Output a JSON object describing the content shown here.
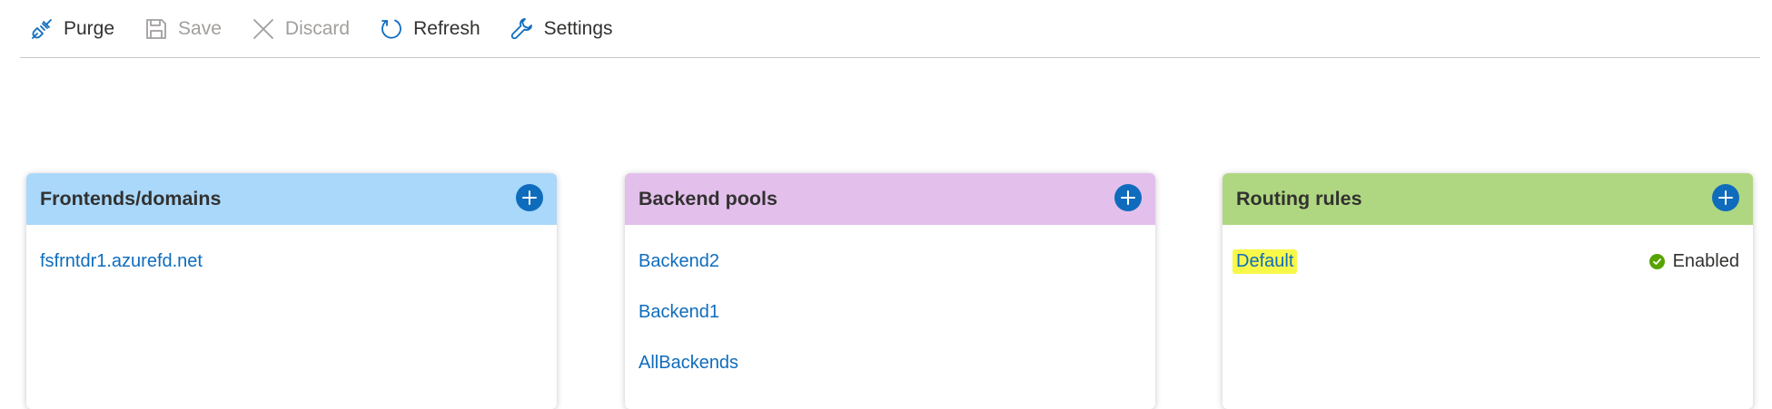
{
  "toolbar": {
    "purge": "Purge",
    "save": "Save",
    "discard": "Discard",
    "refresh": "Refresh",
    "settings": "Settings"
  },
  "panels": {
    "frontends": {
      "title": "Frontends/domains",
      "header_color": "#a9d8fb",
      "items": [
        "fsfrntdr1.azurefd.net"
      ]
    },
    "backends": {
      "title": "Backend pools",
      "header_color": "#e3bfec",
      "items": [
        "Backend2",
        "Backend1",
        "AllBackends"
      ]
    },
    "routing": {
      "title": "Routing rules",
      "header_color": "#afd781",
      "items": [
        {
          "name": "Default",
          "status": "Enabled"
        }
      ]
    }
  },
  "colors": {
    "accent": "#0f6cbd",
    "enabled": "#57a300",
    "highlight": "#f8f84a"
  }
}
